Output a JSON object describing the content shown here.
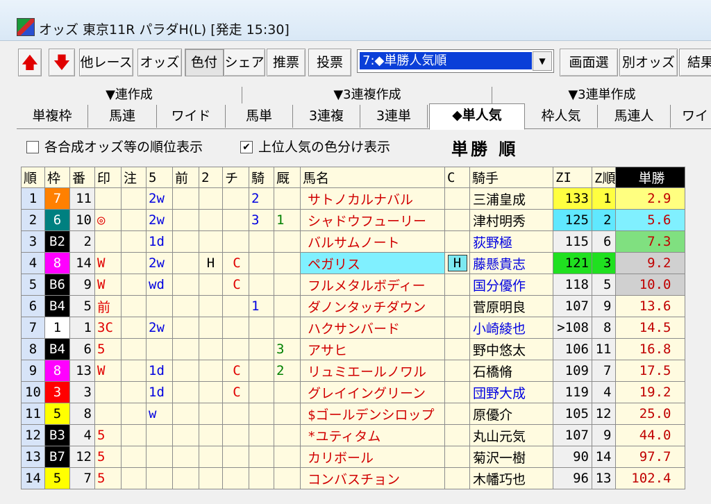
{
  "window": {
    "title": "オッズ 東京11R パラダH(L) [発走 15:30]"
  },
  "toolbar": {
    "other_race": "他レース",
    "odds": "オッズ",
    "color": "色付",
    "share": "シェア",
    "suggest": "推票",
    "vote": "投票",
    "select_value": "7:◆単勝人気順",
    "screen_select": "画面選",
    "other_odds": "別オッズ",
    "result": "結果"
  },
  "groups": [
    "▼連作成",
    "▼3連複作成",
    "▼3連単作成"
  ],
  "tabs": [
    "単複枠",
    "馬連",
    "ワイド",
    "馬単",
    "3連複",
    "3連単",
    "◆単人気",
    "枠人気",
    "馬連人",
    "ワイ"
  ],
  "options": {
    "opt1_label": "各合成オッズ等の順位表示",
    "opt1_checked": false,
    "opt2_label": "上位人気の色分け表示",
    "opt2_checked": true,
    "heading": "単勝 順"
  },
  "columns": [
    "順",
    "枠",
    "番",
    "印",
    "注",
    "5",
    "前",
    "2",
    "チ",
    "騎",
    "厩",
    "馬名",
    "C",
    "騎手",
    "ZI",
    "Z順",
    "単勝"
  ],
  "rows": [
    {
      "rank": "1",
      "waku": "7",
      "ban": "11",
      "mark": "",
      "note": "",
      "five": "2w",
      "mae": "",
      "two": "",
      "chi": "",
      "ki": "2",
      "kyu": "",
      "name": "サトノカルナバル",
      "c": "",
      "jockey": "三浦皇成",
      "jb": false,
      "zi": "133",
      "zr": "1",
      "odds": "2.9"
    },
    {
      "rank": "2",
      "waku": "6",
      "ban": "10",
      "mark": "◎",
      "note": "",
      "five": "2w",
      "mae": "",
      "two": "",
      "chi": "",
      "ki": "3",
      "kyu": "1",
      "name": "シャドウフューリー",
      "c": "",
      "jockey": "津村明秀",
      "jb": false,
      "zi": "125",
      "zr": "2",
      "odds": "5.6"
    },
    {
      "rank": "3",
      "waku": "B2",
      "ban": "2",
      "mark": "",
      "note": "",
      "five": "1d",
      "mae": "",
      "two": "",
      "chi": "",
      "ki": "",
      "kyu": "",
      "name": "バルサムノート",
      "c": "",
      "jockey": "荻野極",
      "jb": true,
      "zi": "115",
      "zr": "6",
      "odds": "7.3"
    },
    {
      "rank": "4",
      "waku": "8",
      "ban": "14",
      "mark": "W",
      "note": "",
      "five": "2w",
      "mae": "",
      "two": "H",
      "chi": "C",
      "ki": "",
      "kyu": "",
      "name": "ペガリス",
      "c": "H",
      "jockey": "藤懸貴志",
      "jb": true,
      "zi": "121",
      "zr": "3",
      "odds": "9.2"
    },
    {
      "rank": "5",
      "waku": "B6",
      "ban": "9",
      "mark": "W",
      "note": "",
      "five": "wd",
      "mae": "",
      "two": "",
      "chi": "C",
      "ki": "",
      "kyu": "",
      "name": "フルメタルボディー",
      "c": "",
      "jockey": "国分優作",
      "jb": true,
      "zi": "118",
      "zr": "5",
      "odds": "10.0"
    },
    {
      "rank": "6",
      "waku": "B4",
      "ban": "5",
      "mark": "前",
      "note": "",
      "five": "",
      "mae": "",
      "two": "",
      "chi": "",
      "ki": "1",
      "kyu": "",
      "name": "ダノンタッチダウン",
      "c": "",
      "jockey": "菅原明良",
      "jb": false,
      "zi": "107",
      "zr": "9",
      "odds": "13.6"
    },
    {
      "rank": "7",
      "waku": "1",
      "ban": "1",
      "mark": "3C",
      "note": "",
      "five": "2w",
      "mae": "",
      "two": "",
      "chi": "",
      "ki": "",
      "kyu": "",
      "name": "ハクサンバード",
      "c": "",
      "jockey": "小崎綾也",
      "jb": true,
      "zi": ">108",
      "zr": "8",
      "odds": "14.5"
    },
    {
      "rank": "8",
      "waku": "B4",
      "ban": "6",
      "mark": "5",
      "note": "",
      "five": "",
      "mae": "",
      "two": "",
      "chi": "",
      "ki": "",
      "kyu": "3",
      "name": "アサヒ",
      "c": "",
      "jockey": "野中悠太",
      "jb": false,
      "zi": "106",
      "zr": "11",
      "odds": "16.8"
    },
    {
      "rank": "9",
      "waku": "8",
      "ban": "13",
      "mark": "W",
      "note": "",
      "five": "1d",
      "mae": "",
      "two": "",
      "chi": "C",
      "ki": "",
      "kyu": "2",
      "name": "リュミエールノワル",
      "c": "",
      "jockey": "石橋脩",
      "jb": false,
      "zi": "109",
      "zr": "7",
      "odds": "17.5"
    },
    {
      "rank": "10",
      "waku": "3",
      "ban": "3",
      "mark": "",
      "note": "",
      "five": "1d",
      "mae": "",
      "two": "",
      "chi": "C",
      "ki": "",
      "kyu": "",
      "name": "グレイイングリーン",
      "c": "",
      "jockey": "団野大成",
      "jb": true,
      "zi": "119",
      "zr": "4",
      "odds": "19.2"
    },
    {
      "rank": "11",
      "waku": "5",
      "ban": "8",
      "mark": "",
      "note": "",
      "five": "w",
      "mae": "",
      "two": "",
      "chi": "",
      "ki": "",
      "kyu": "",
      "name": "$ゴールデンシロップ",
      "c": "",
      "jockey": "原優介",
      "jb": false,
      "zi": "105",
      "zr": "12",
      "odds": "25.0"
    },
    {
      "rank": "12",
      "waku": "B3",
      "ban": "4",
      "mark": "5",
      "note": "",
      "five": "",
      "mae": "",
      "two": "",
      "chi": "",
      "ki": "",
      "kyu": "",
      "name": "*ユティタム",
      "c": "",
      "jockey": "丸山元気",
      "jb": false,
      "zi": "107",
      "zr": "9",
      "odds": "44.0"
    },
    {
      "rank": "13",
      "waku": "B7",
      "ban": "12",
      "mark": "5",
      "note": "",
      "five": "",
      "mae": "",
      "two": "",
      "chi": "",
      "ki": "",
      "kyu": "",
      "name": "カリボール",
      "c": "",
      "jockey": "菊沢一樹",
      "jb": false,
      "zi": "90",
      "zr": "14",
      "odds": "97.7"
    },
    {
      "rank": "14",
      "waku": "5",
      "ban": "7",
      "mark": "5",
      "note": "",
      "five": "",
      "mae": "",
      "two": "",
      "chi": "",
      "ki": "",
      "kyu": "",
      "name": "コンバスチョン",
      "c": "",
      "jockey": "木幡巧也",
      "jb": false,
      "zi": "96",
      "zr": "13",
      "odds": "102.4"
    }
  ],
  "colors": {
    "waku": {
      "1": "#ffffff",
      "2": "#000000",
      "3": "#ff0000",
      "4": "#0000ff",
      "5": "#ffff00",
      "6": "#008080",
      "7": "#ff8000",
      "8": "#ff00ff",
      "B": "#000000"
    },
    "zi_top": [
      "#ffff40",
      "#60e8ff",
      "#ffffff",
      "#20e020"
    ],
    "odds_top": [
      "#ffff80",
      "#80f0ff",
      "#80e080",
      "#d0d0d0",
      "#d0d0d0"
    ]
  }
}
